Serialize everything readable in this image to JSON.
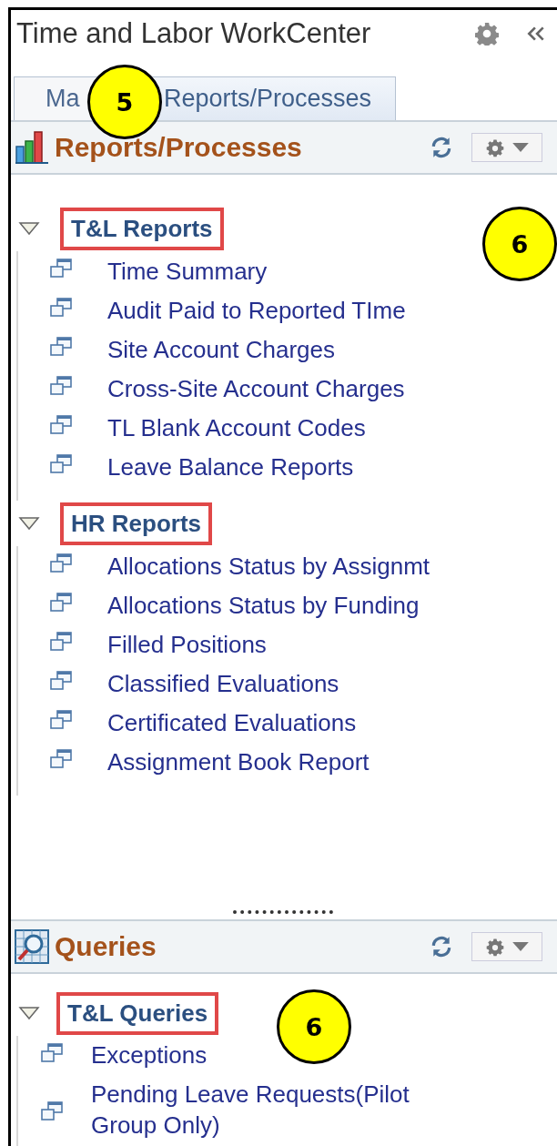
{
  "window": {
    "title": "Time and Labor WorkCenter"
  },
  "tabs": [
    {
      "label": "Ma",
      "selected": false
    },
    {
      "label": "Reports/Processes",
      "selected": true
    }
  ],
  "panels": [
    {
      "kind": "reports",
      "title": "Reports/Processes",
      "groups": [
        {
          "label": "T&L Reports",
          "expanded": true,
          "highlighted": true,
          "children": [
            {
              "label": "Time Summary"
            },
            {
              "label": "Audit Paid to Reported TIme"
            },
            {
              "label": "Site Account Charges"
            },
            {
              "label": "Cross-Site Account Charges"
            },
            {
              "label": "TL Blank Account Codes"
            },
            {
              "label": "Leave Balance Reports"
            }
          ]
        },
        {
          "label": "HR Reports",
          "expanded": true,
          "highlighted": true,
          "children": [
            {
              "label": "Allocations Status by Assignmt"
            },
            {
              "label": "Allocations Status by Funding"
            },
            {
              "label": "Filled Positions"
            },
            {
              "label": "Classified Evaluations"
            },
            {
              "label": "Certificated Evaluations"
            },
            {
              "label": "Assignment Book Report"
            }
          ]
        }
      ]
    },
    {
      "kind": "queries",
      "title": "Queries",
      "groups": [
        {
          "label": "T&L Queries",
          "expanded": true,
          "highlighted": true,
          "children": [
            {
              "label": "Exceptions"
            },
            {
              "label": "Pending Leave Requests(Pilot Group Only)"
            }
          ]
        }
      ]
    }
  ],
  "callouts": [
    {
      "text": "5"
    },
    {
      "text": "6"
    },
    {
      "text": "6"
    }
  ]
}
